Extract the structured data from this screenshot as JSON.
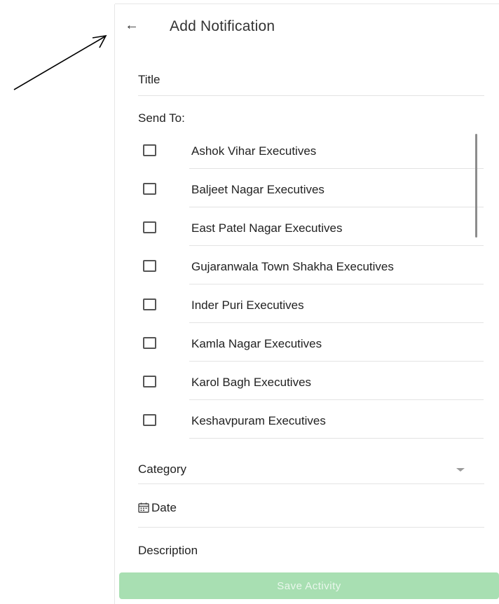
{
  "appbar": {
    "title": "Add Notification",
    "back_icon": "arrow-left-icon"
  },
  "form": {
    "title_label": "Title",
    "send_to_label": "Send To:",
    "recipients": [
      {
        "label": "Ashok Vihar Executives",
        "checked": false
      },
      {
        "label": "Baljeet Nagar Executives",
        "checked": false
      },
      {
        "label": "East Patel Nagar Executives",
        "checked": false
      },
      {
        "label": "Gujaranwala Town Shakha Executives",
        "checked": false
      },
      {
        "label": "Inder Puri Executives",
        "checked": false
      },
      {
        "label": "Kamla Nagar Executives",
        "checked": false
      },
      {
        "label": "Karol Bagh Executives",
        "checked": false
      },
      {
        "label": "Keshavpuram Executives",
        "checked": false
      }
    ],
    "category_label": "Category",
    "date_label": "Date",
    "date_icon": "calendar-icon",
    "description_label": "Description"
  },
  "actions": {
    "save_label": "Save Activity"
  },
  "colors": {
    "save_button_bg": "#a8dfb2",
    "save_button_text": "#e9f7ec",
    "divider": "#e3e3e3"
  }
}
